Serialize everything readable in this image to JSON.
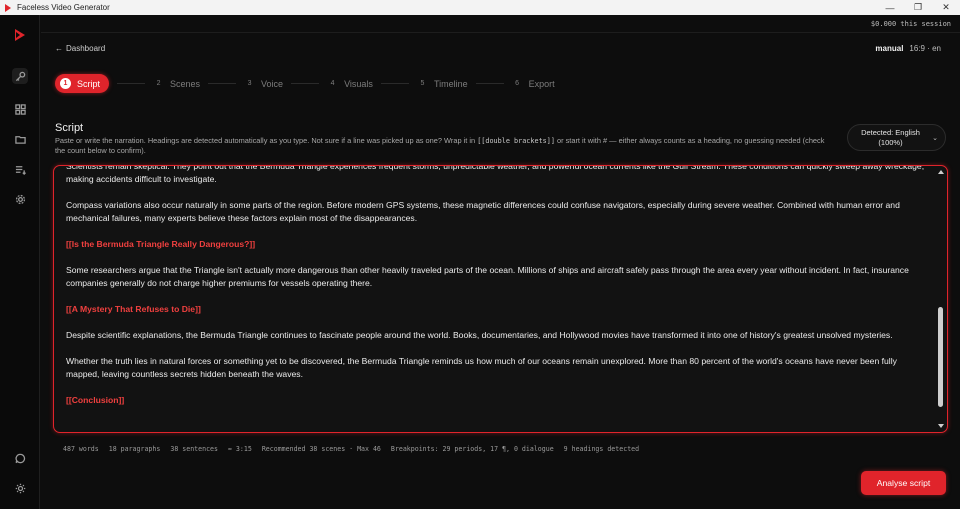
{
  "window": {
    "title": "Faceless Video Generator",
    "controls": {
      "minimize": "—",
      "maximize": "❐",
      "close": "✕"
    }
  },
  "session": {
    "cost": "$0.000 this session"
  },
  "nav": {
    "back_label": "Dashboard"
  },
  "mode": {
    "name": "manual",
    "format": "16:9 · en"
  },
  "steps": [
    {
      "num": "1",
      "label": "Script",
      "active": true
    },
    {
      "num": "2",
      "label": "Scenes"
    },
    {
      "num": "3",
      "label": "Voice"
    },
    {
      "num": "4",
      "label": "Visuals"
    },
    {
      "num": "5",
      "label": "Timeline"
    },
    {
      "num": "6",
      "label": "Export"
    }
  ],
  "script": {
    "title": "Script",
    "help_a": "Paste or write the narration. Headings are detected automatically as you type. Not sure if a line was picked up as one? Wrap it in ",
    "help_code": "[[double brackets]]",
    "help_b": " or start it with # — either always counts as a heading, no guessing needed (check the count below to confirm).",
    "language_line1": "Detected: English",
    "language_line2": "(100%)",
    "paragraphs": [
      {
        "text": "Scientists remain skeptical. They point out that the Bermuda Triangle experiences frequent storms, unpredictable weather, and powerful ocean currents like the Gulf Stream. These conditions can quickly sweep away wreckage, making accidents difficult to investigate."
      },
      {
        "text": "Compass variations also occur naturally in some parts of the region. Before modern GPS systems, these magnetic differences could confuse navigators, especially during severe weather. Combined with human error and mechanical failures, many experts believe these factors explain most of the disappearances."
      },
      {
        "text": "[[Is the Bermuda Triangle Really Dangerous?]]",
        "heading": true
      },
      {
        "text": "Some researchers argue that the Triangle isn't actually more dangerous than other heavily traveled parts of the ocean. Millions of ships and aircraft safely pass through the area every year without incident. In fact, insurance companies generally do not charge higher premiums for vessels operating there."
      },
      {
        "text": "[[A Mystery That Refuses to Die]]",
        "heading": true
      },
      {
        "text": "Despite scientific explanations, the Bermuda Triangle continues to fascinate people around the world. Books, documentaries, and Hollywood movies have transformed it into one of history's greatest unsolved mysteries."
      },
      {
        "text": "Whether the truth lies in natural forces or something yet to be discovered, the Bermuda Triangle reminds us how much of our oceans remain unexplored. More than 80 percent of the world's oceans have never been fully mapped, leaving countless secrets hidden beneath the waves."
      },
      {
        "text": "[[Conclusion]]",
        "heading": true
      }
    ],
    "scroll_position": 0.6
  },
  "stats": {
    "words": "487 words",
    "paragraphs": "18 paragraphs",
    "sentences": "38 sentences",
    "duration": "≈ 3:15",
    "scenes": "Recommended 38 scenes · Max 46",
    "breakpoints": "Breakpoints: 29 periods, 17 ¶, 0 dialogue",
    "headings": "9 headings detected"
  },
  "actions": {
    "analyse_label": "Analyse script"
  },
  "colors": {
    "accent": "#e0242b",
    "heading_text": "#f0403f",
    "background": "#0d0d0d"
  },
  "icons": {
    "rail": [
      "logo-play-icon",
      "key-icon",
      "grid-icon",
      "folder-icon",
      "list-icon",
      "gear-icon",
      "chat-icon",
      "sun-icon"
    ]
  }
}
